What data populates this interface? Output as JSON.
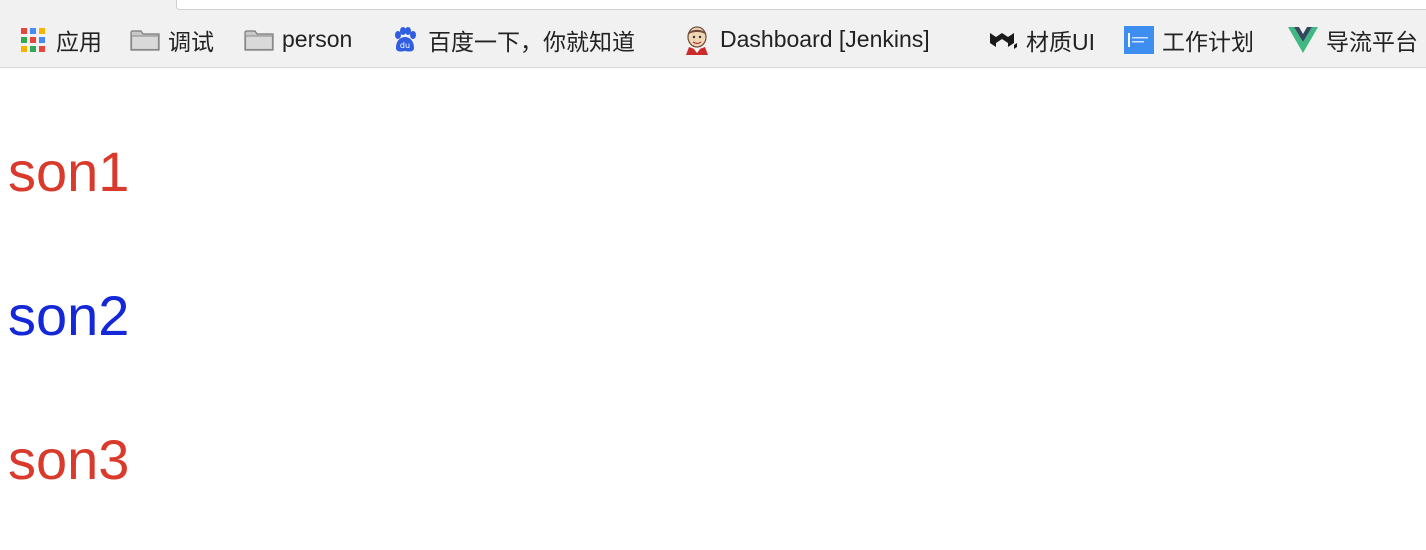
{
  "bookmarks_bar": {
    "items": [
      {
        "label": "应用",
        "icon": "apps-grid-icon"
      },
      {
        "label": "调试",
        "icon": "folder-icon"
      },
      {
        "label": "person",
        "icon": "folder-icon"
      },
      {
        "label": "百度一下，你就知道",
        "icon": "baidu-paw-icon"
      },
      {
        "label": "Dashboard [Jenkins]",
        "icon": "jenkins-butler-icon"
      },
      {
        "label": "材质UI",
        "icon": "material-ui-logo-icon"
      },
      {
        "label": "工作计划",
        "icon": "work-plan-icon"
      },
      {
        "label": "导流平台",
        "icon": "vue-logo-icon"
      }
    ]
  },
  "content": {
    "lines": [
      {
        "text": "son1",
        "color": "#d93a2b"
      },
      {
        "text": "son2",
        "color": "#1428d8"
      },
      {
        "text": "son3",
        "color": "#d93a2b"
      }
    ]
  }
}
